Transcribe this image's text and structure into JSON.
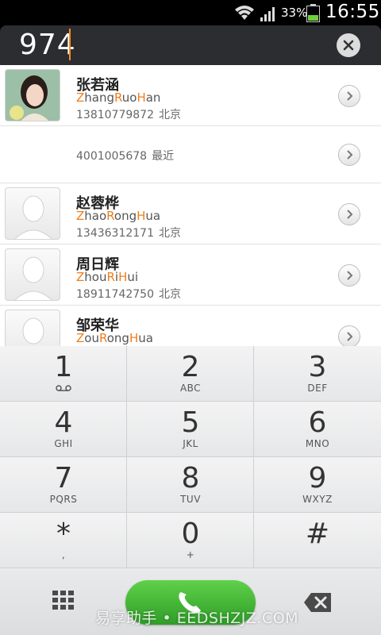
{
  "status_bar": {
    "battery_percent": "33%",
    "time": "16:55"
  },
  "search": {
    "query": "974"
  },
  "contacts": [
    {
      "name": "张若涵",
      "pinyin": [
        [
          "Z",
          "h"
        ],
        [
          "hang",
          ""
        ],
        [
          "R",
          "h"
        ],
        [
          "uo",
          ""
        ],
        [
          "H",
          "h"
        ],
        [
          "an",
          ""
        ]
      ],
      "number": "13810779872",
      "location": "北京",
      "has_photo": true
    },
    {
      "name": "",
      "pinyin": [],
      "number": "4001005678",
      "location": "最近",
      "has_photo": false
    },
    {
      "name": "赵蓉桦",
      "pinyin": [
        [
          "Z",
          "h"
        ],
        [
          "hao",
          ""
        ],
        [
          "R",
          "h"
        ],
        [
          "ong",
          ""
        ],
        [
          "H",
          "h"
        ],
        [
          "ua",
          ""
        ]
      ],
      "number": "13436312171",
      "location": "北京",
      "has_photo": false
    },
    {
      "name": "周日辉",
      "pinyin": [
        [
          "Z",
          "h"
        ],
        [
          "hou",
          ""
        ],
        [
          "R",
          "h"
        ],
        [
          "i",
          ""
        ],
        [
          "H",
          "h"
        ],
        [
          "ui",
          ""
        ]
      ],
      "number": "18911742750",
      "location": "北京",
      "has_photo": false
    },
    {
      "name": "邹荣华",
      "pinyin": [
        [
          "Z",
          "h"
        ],
        [
          "ou",
          ""
        ],
        [
          "R",
          "h"
        ],
        [
          "ong",
          ""
        ],
        [
          "H",
          "h"
        ],
        [
          "ua",
          ""
        ]
      ],
      "number": "",
      "location": "",
      "has_photo": false
    }
  ],
  "keypad": [
    {
      "digit": "1",
      "letters": ""
    },
    {
      "digit": "2",
      "letters": "ABC"
    },
    {
      "digit": "3",
      "letters": "DEF"
    },
    {
      "digit": "4",
      "letters": "GHI"
    },
    {
      "digit": "5",
      "letters": "JKL"
    },
    {
      "digit": "6",
      "letters": "MNO"
    },
    {
      "digit": "7",
      "letters": "PQRS"
    },
    {
      "digit": "8",
      "letters": "TUV"
    },
    {
      "digit": "9",
      "letters": "WXYZ"
    },
    {
      "digit": "*",
      "letters": ","
    },
    {
      "digit": "0",
      "letters": "+"
    },
    {
      "digit": "#",
      "letters": ""
    }
  ],
  "watermark": "易享助手 • EEDSHZJZ.COM",
  "colors": {
    "highlight": "#f07d1a",
    "call_green": "#3cb033",
    "caret": "#ff8a1e"
  }
}
